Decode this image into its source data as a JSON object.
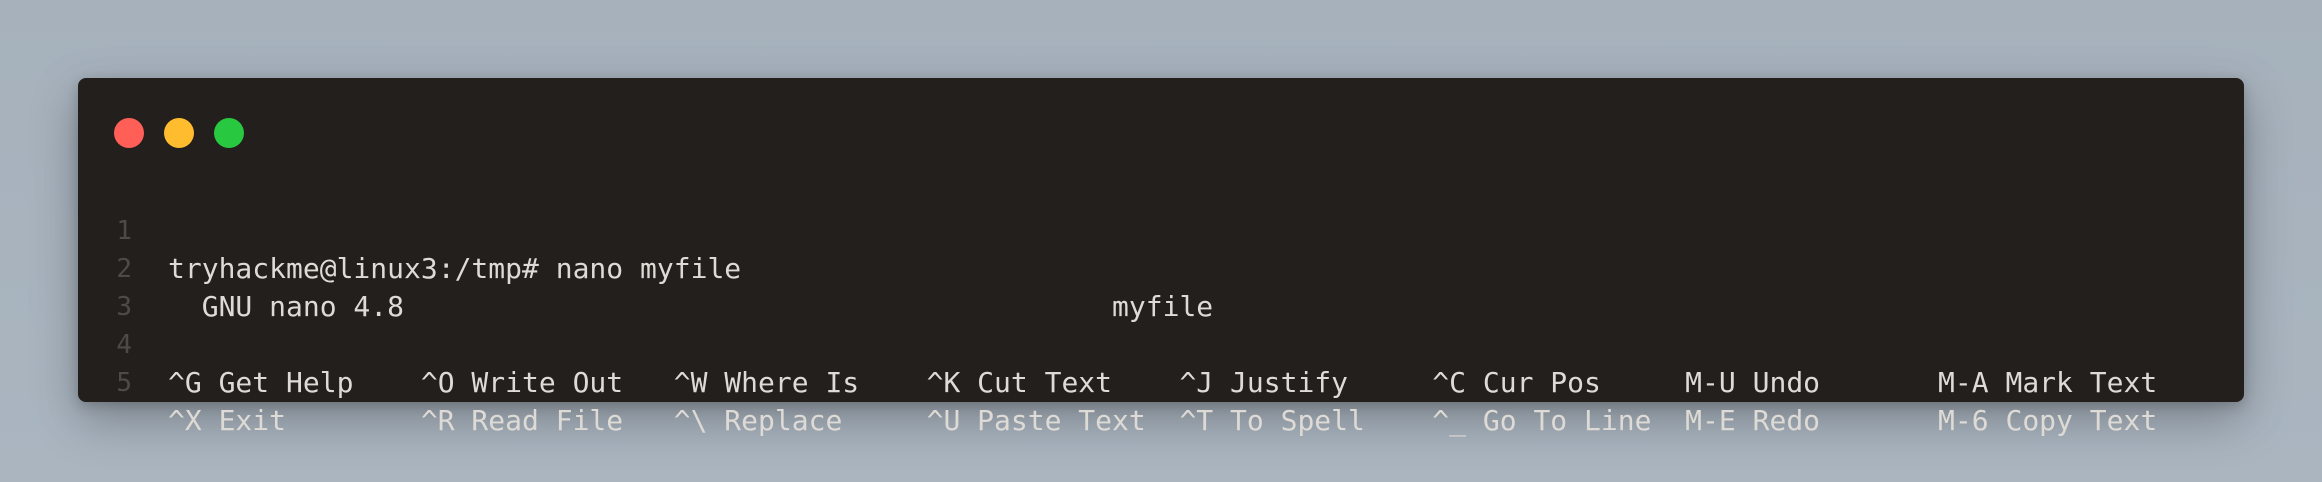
{
  "window": {
    "controls": {
      "close_color": "#ff5f57",
      "minimize_color": "#febc2e",
      "maximize_color": "#28c840"
    }
  },
  "lines": [
    {
      "number": "1",
      "text": "tryhackme@linux3:/tmp# nano myfile"
    },
    {
      "number": "2",
      "text": "  GNU nano 4.8                                          myfile"
    },
    {
      "number": "3",
      "text": ""
    },
    {
      "number": "4",
      "text": "^G Get Help    ^O Write Out   ^W Where Is    ^K Cut Text    ^J Justify     ^C Cur Pos     M-U Undo       M-A Mark Text"
    },
    {
      "number": "5",
      "text": "^X Exit        ^R Read File   ^\\ Replace     ^U Paste Text  ^T To Spell    ^_ Go To Line  M-E Redo       M-6 Copy Text"
    }
  ]
}
